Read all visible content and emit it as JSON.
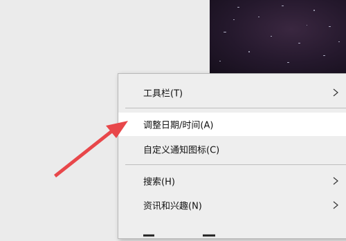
{
  "context_menu": {
    "items": [
      {
        "label": "工具栏(T)",
        "has_submenu": true
      },
      {
        "label": "调整日期/时间(A)",
        "has_submenu": false,
        "highlighted": true
      },
      {
        "label": "自定义通知图标(C)",
        "has_submenu": false
      },
      {
        "label": "搜索(H)",
        "has_submenu": true
      },
      {
        "label": "资讯和兴趣(N)",
        "has_submenu": true
      }
    ]
  },
  "annotation": {
    "arrow_color": "#e8474a",
    "points_to": "调整日期/时间(A)"
  },
  "colors": {
    "desktop_background": "#ebebeb",
    "menu_background": "#eeeeee",
    "menu_hover": "#ffffff",
    "separator": "#bdbdbd"
  }
}
